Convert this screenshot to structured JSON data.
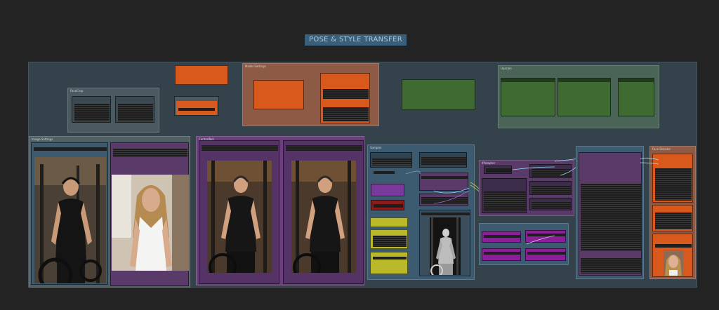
{
  "title": "POSE & STYLE TRANSFER",
  "groups": {
    "face_crop": "FaceCrop",
    "model_settings": "Model Settings",
    "upscale": "Upscale",
    "image_settings": "Image Settings",
    "controlnet": "ControlNet",
    "sampler": "Sampler",
    "ipadapter": "IPAdapter",
    "face_detailer": "Face Detailer"
  },
  "colors": {
    "background": "#232323",
    "board": "#33424b",
    "orange": "#d9581c",
    "green": "#3f6b33",
    "purple": "#5a3a68",
    "magenta": "#8c1e9c",
    "yellow": "#b9b92a",
    "red": "#8a1c1c"
  }
}
